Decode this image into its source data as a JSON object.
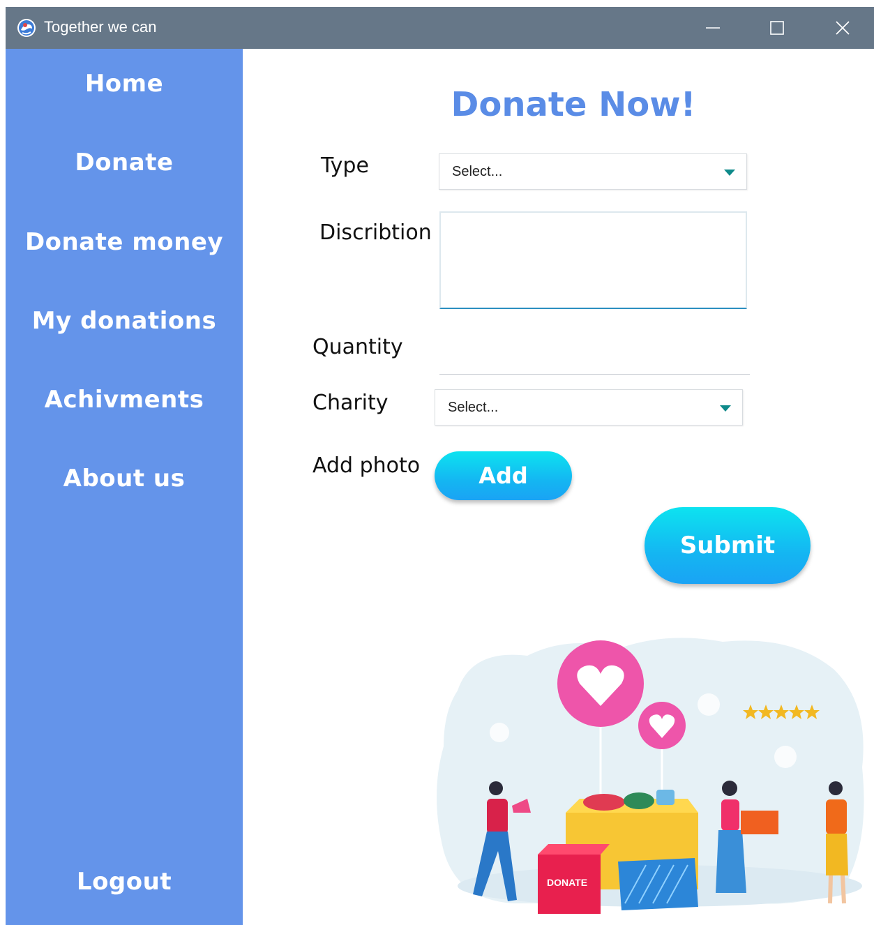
{
  "window": {
    "title": "Together we can"
  },
  "sidebar": {
    "items": [
      {
        "label": "Home"
      },
      {
        "label": "Donate"
      },
      {
        "label": "Donate money"
      },
      {
        "label": "My donations"
      },
      {
        "label": "Achivments"
      },
      {
        "label": "About us"
      }
    ],
    "logout": "Logout"
  },
  "form": {
    "heading": "Donate Now!",
    "type_label": "Type",
    "type_value": "Select...",
    "description_label": "Discribtion",
    "description_value": "",
    "quantity_label": "Quantity",
    "quantity_value": "",
    "charity_label": "Charity",
    "charity_value": "Select...",
    "photo_label": "Add photo",
    "add_button": "Add",
    "submit_button": "Submit"
  },
  "illustration": {
    "box_text": "DONATE",
    "rating_stars": 5
  },
  "colors": {
    "titlebar": "#667788",
    "sidebar": "#6494ea",
    "heading": "#5a8ce6",
    "accent": "#14b6f2",
    "caret": "#0e8a8a"
  }
}
